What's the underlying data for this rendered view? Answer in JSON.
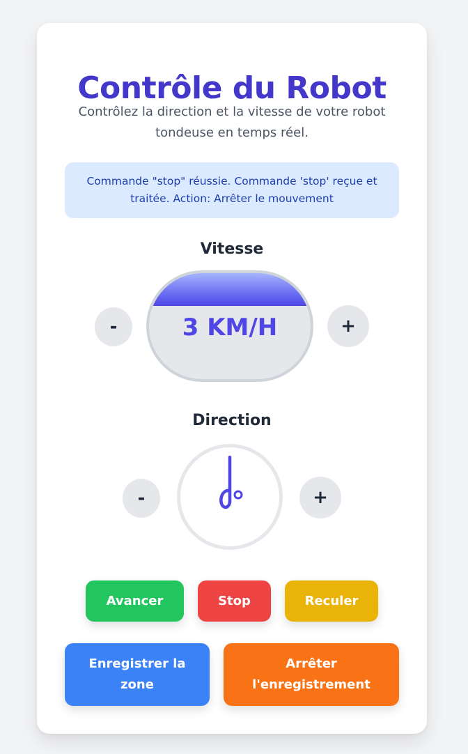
{
  "header": {
    "title": "Contrôle du Robot",
    "subtitle": "Contrôlez la direction et la vitesse de votre robot tondeuse en temps réel."
  },
  "status_message": "Commande \"stop\" réussie. Commande 'stop' reçue et traitée. Action: Arrêter le mouvement",
  "speed": {
    "label": "Vitesse",
    "value_text": "3 KM/H",
    "decrease_label": "-",
    "increase_label": "+"
  },
  "direction": {
    "label": "Direction",
    "decrease_label": "-",
    "increase_label": "+",
    "indicator_icon": "compass-needle-icon"
  },
  "actions": {
    "forward": "Avancer",
    "stop": "Stop",
    "backward": "Reculer",
    "record_zone": "Enregistrer la zone",
    "stop_recording": "Arrêter l'enregistrement"
  },
  "colors": {
    "accent": "#4338ca",
    "forward": "#22c55e",
    "stop": "#ef4444",
    "backward": "#eab308",
    "record": "#3b82f6",
    "stop_recording": "#f97316"
  }
}
